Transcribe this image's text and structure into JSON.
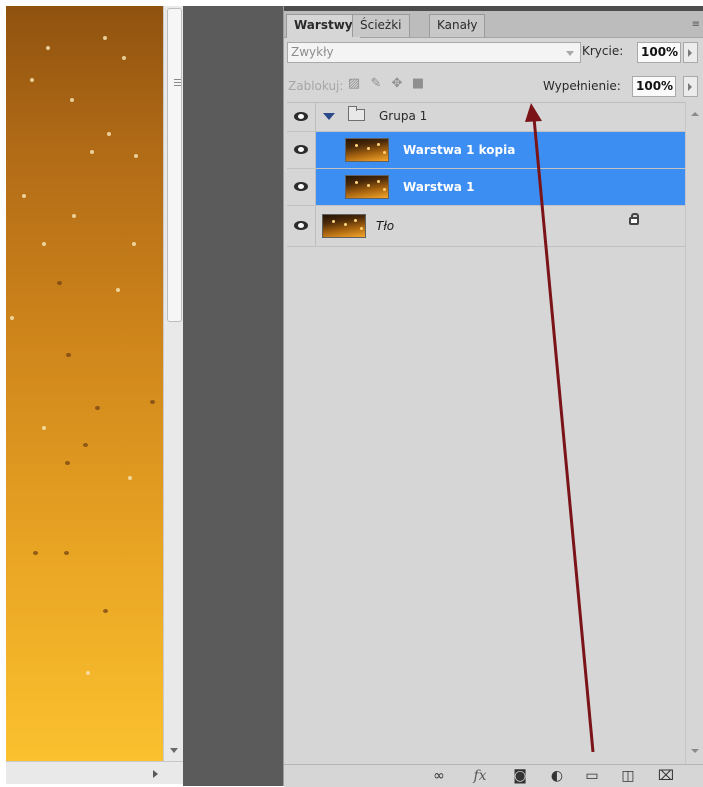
{
  "panel": {
    "tabs": [
      {
        "label": "Warstwy",
        "active": true
      },
      {
        "label": "Ścieżki",
        "active": false
      },
      {
        "label": "Kanały",
        "active": false
      }
    ],
    "menu_icon": "≡",
    "blend_mode": "Zwykły",
    "opacity_label": "Krycie:",
    "opacity_value": "100%",
    "lock_label": "Zablokuj:",
    "fill_label": "Wypełnienie:",
    "fill_value": "100%"
  },
  "layers": [
    {
      "name": "Grupa 1",
      "type": "group",
      "visible": true,
      "expanded": true,
      "selected": false
    },
    {
      "name": "Warstwa 1 kopia",
      "type": "pixel",
      "visible": true,
      "selected": true
    },
    {
      "name": "Warstwa 1",
      "type": "pixel",
      "visible": true,
      "selected": true
    },
    {
      "name": "Tło",
      "type": "background",
      "visible": true,
      "selected": false,
      "locked": true
    }
  ],
  "bottom_bar": {
    "icons": [
      "link-layers-icon",
      "fx-icon",
      "layer-mask-icon",
      "adjustment-layer-icon",
      "new-group-icon",
      "new-layer-icon",
      "trash-icon"
    ],
    "fx_text": "fx"
  },
  "colors": {
    "selection": "#3d8ef3",
    "annotation_arrow": "#7a1418",
    "panel_bg": "#d6d6d6",
    "gutter": "#5b5b5b"
  }
}
